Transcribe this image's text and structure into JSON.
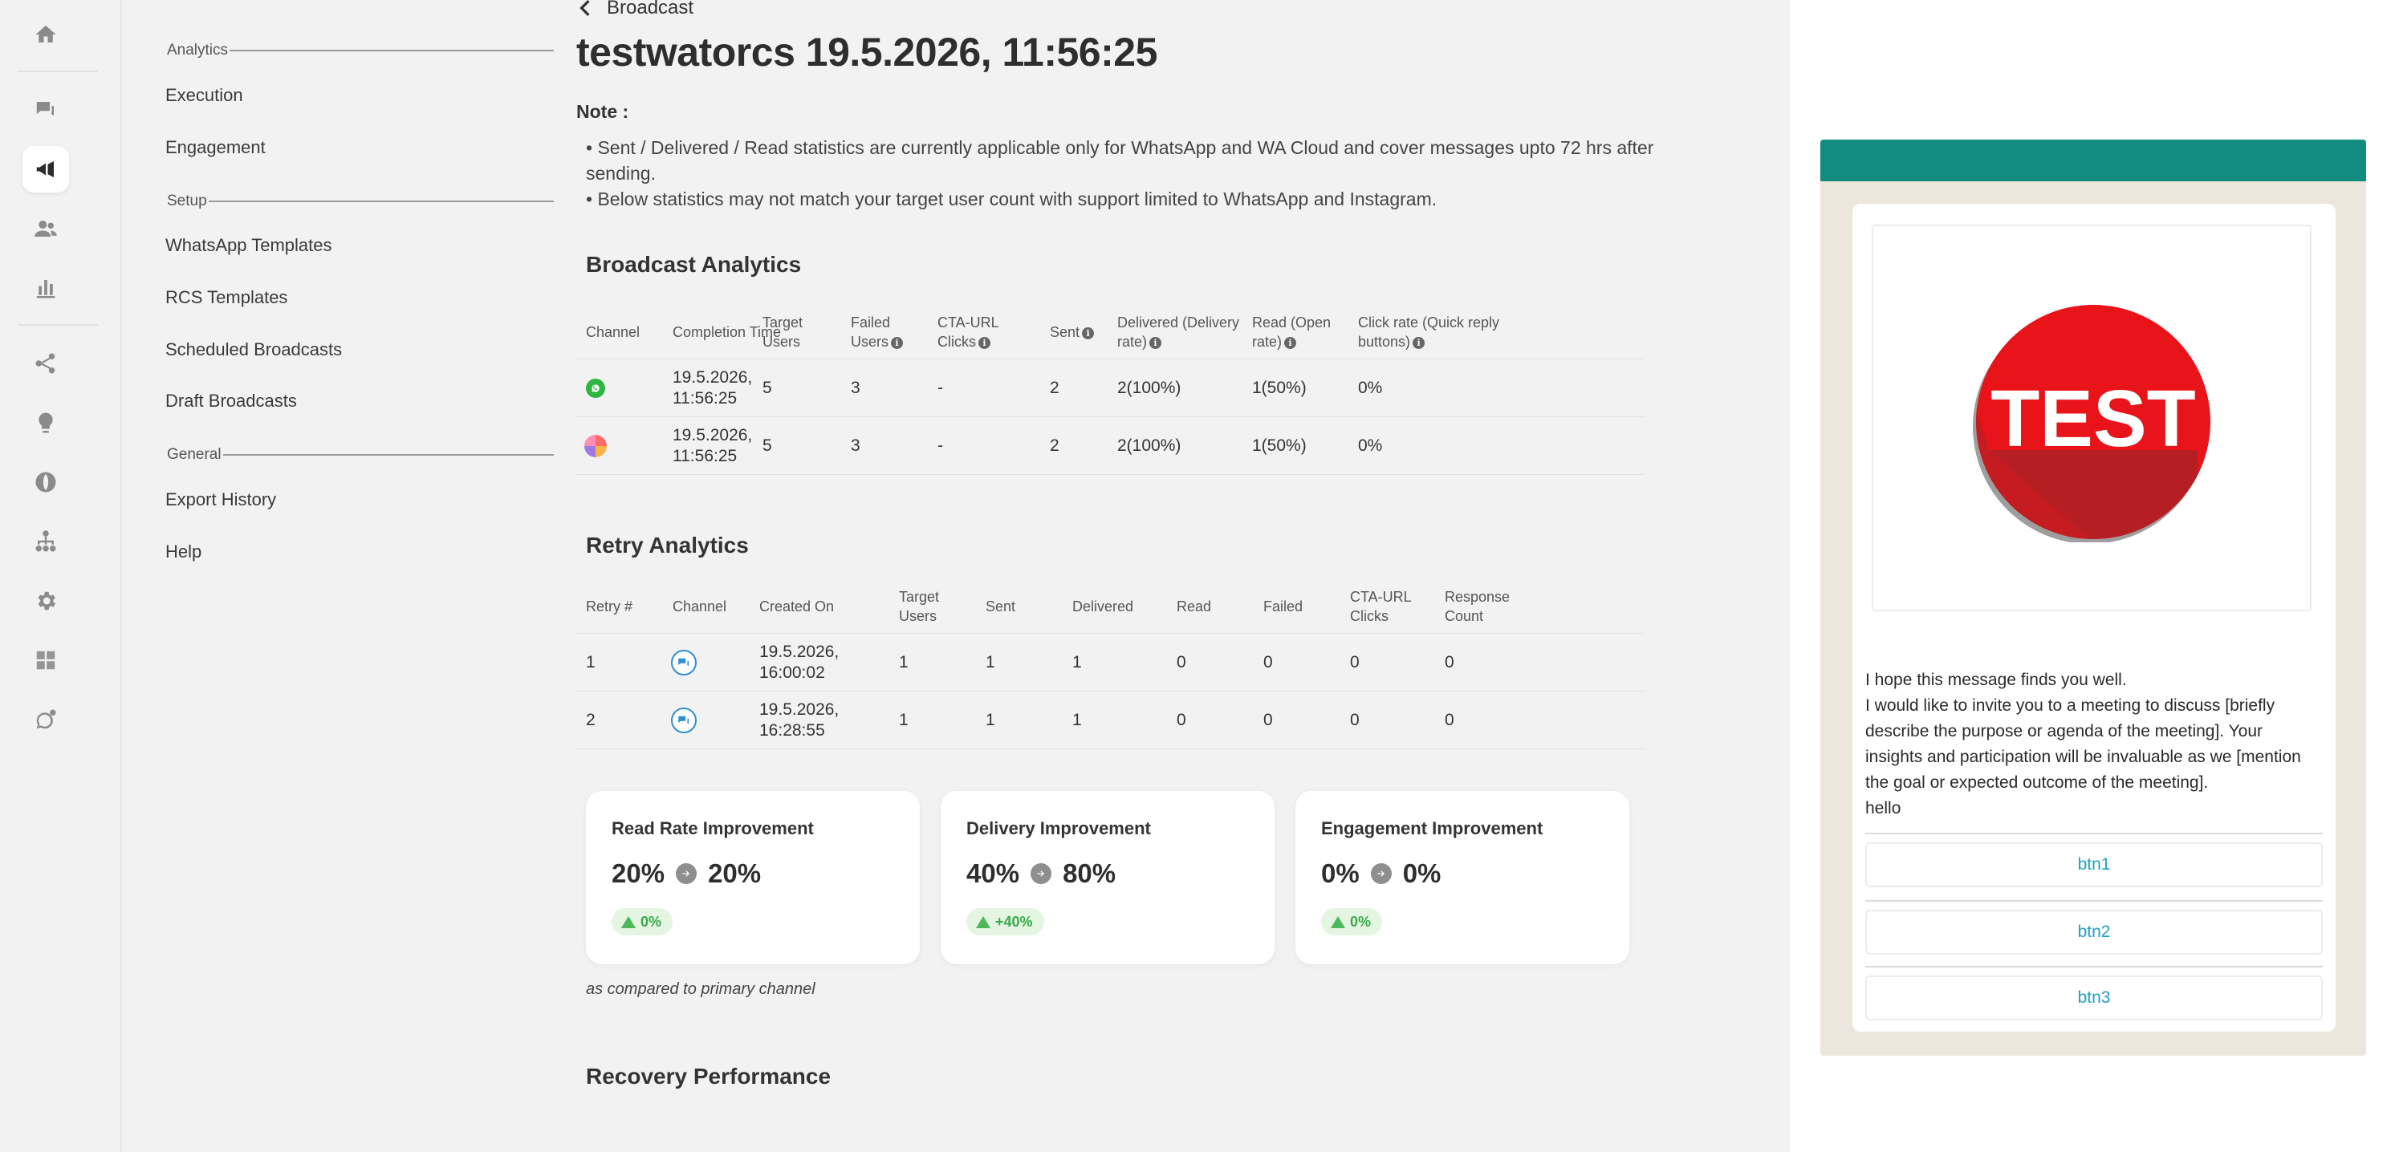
{
  "rail": {
    "icons": [
      "home-icon",
      "chat-icon",
      "broadcast-icon",
      "users-icon",
      "analytics-icon",
      "flow-icon",
      "bulb-icon",
      "globe-icon",
      "hierarchy-icon",
      "settings-icon",
      "integrations-icon",
      "whatsapp-settings-icon"
    ],
    "active": "broadcast-icon"
  },
  "submenu": {
    "sections": [
      {
        "title": "Analytics",
        "items": [
          "Execution",
          "Engagement"
        ]
      },
      {
        "title": "Setup",
        "items": [
          "WhatsApp Templates",
          "RCS Templates",
          "Scheduled Broadcasts",
          "Draft Broadcasts"
        ]
      },
      {
        "title": "General",
        "items": [
          "Export History",
          "Help"
        ]
      }
    ]
  },
  "header": {
    "back_label": "Broadcast",
    "title": "testwatorcs 19.5.2026, 11:56:25"
  },
  "note": {
    "label": "Note :",
    "lines": [
      "• Sent / Delivered / Read statistics are currently applicable only for WhatsApp and WA Cloud and cover messages upto 72 hrs after sending.",
      "• Below statistics may not match your target user count with support limited to WhatsApp and Instagram."
    ]
  },
  "broadcast_analytics": {
    "title": "Broadcast Analytics",
    "columns": [
      "Channel",
      "Completion Time",
      "Target Users",
      "Failed Users",
      "CTA-URL Clicks",
      "Sent",
      "Delivered (Delivery rate)",
      "Read (Open rate)",
      "Click rate (Quick reply buttons)"
    ],
    "rows": [
      {
        "channel_icon": "whatsapp-icon",
        "completion_time": "19.5.2026, 11:56:25",
        "target": "5",
        "failed": "3",
        "cta": "-",
        "sent": "2",
        "delivered": "2(100%)",
        "read": "1(50%)",
        "click_rate": "0%"
      },
      {
        "channel_icon": "instagram-icon",
        "completion_time": "19.5.2026, 11:56:25",
        "target": "5",
        "failed": "3",
        "cta": "-",
        "sent": "2",
        "delivered": "2(100%)",
        "read": "1(50%)",
        "click_rate": "0%"
      }
    ]
  },
  "retry_analytics": {
    "title": "Retry Analytics",
    "columns": [
      "Retry #",
      "Channel",
      "Created On",
      "Target Users",
      "Sent",
      "Delivered",
      "Read",
      "Failed",
      "CTA-URL Clicks",
      "Response Count"
    ],
    "rows": [
      {
        "retry": "1",
        "channel_icon": "rcs-icon",
        "created_on": "19.5.2026, 16:00:02",
        "target": "1",
        "sent": "1",
        "delivered": "1",
        "read": "0",
        "failed": "0",
        "cta": "0",
        "response": "0"
      },
      {
        "retry": "2",
        "channel_icon": "rcs-icon",
        "created_on": "19.5.2026, 16:28:55",
        "target": "1",
        "sent": "1",
        "delivered": "1",
        "read": "0",
        "failed": "0",
        "cta": "0",
        "response": "0"
      }
    ]
  },
  "improvement_cards": [
    {
      "title": "Read Rate Improvement",
      "from": "20%",
      "to": "20%",
      "delta": "0%"
    },
    {
      "title": "Delivery Improvement",
      "from": "40%",
      "to": "80%",
      "delta": "+40%"
    },
    {
      "title": "Engagement Improvement",
      "from": "0%",
      "to": "0%",
      "delta": "0%"
    }
  ],
  "compare_note": "as compared to primary channel",
  "recovery_title": "Recovery Performance",
  "preview": {
    "media_text": "TEST",
    "message_lines": [
      "I hope this message finds you well.",
      "I would like to invite you to a meeting to discuss [briefly describe the purpose or agenda of the meeting]. Your insights and participation will be invaluable as we [mention the goal or expected outcome of the meeting]."
    ],
    "footer_text": "hello",
    "buttons": [
      "btn1",
      "btn2",
      "btn3"
    ]
  },
  "colors": {
    "whatsapp_header": "#128c7e",
    "button_text": "#1ea0c6",
    "badge_green": "#39a94a",
    "test_red": "#e8141a"
  }
}
